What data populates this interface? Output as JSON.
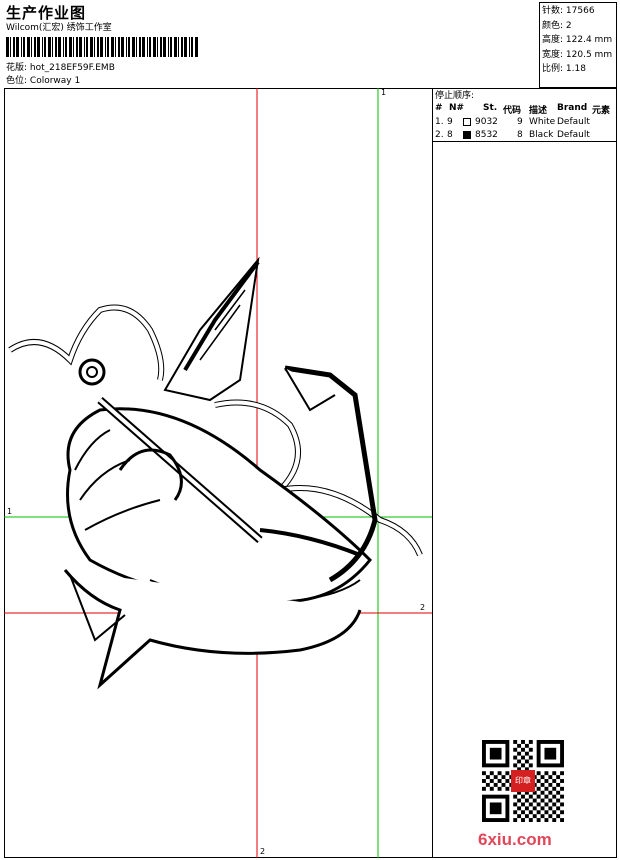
{
  "header": {
    "title": "生产作业图",
    "company": "Wilcom(汇宏) 绣饰工作室",
    "design_label": "花版:",
    "design_value": "hot_218EF59F.EMB",
    "colorway_label": "色位:",
    "colorway_value": "Colorway 1"
  },
  "stats": [
    {
      "label": "针数:",
      "value": "17566"
    },
    {
      "label": "颜色:",
      "value": "2"
    },
    {
      "label": "高度:",
      "value": "122.4 mm"
    },
    {
      "label": "宽度:",
      "value": "120.5 mm"
    },
    {
      "label": "比例:",
      "value": "1.18"
    }
  ],
  "stop_sequence": {
    "title": "停止顺序:",
    "columns": [
      "#",
      "N#",
      "St.",
      "代码",
      "描述",
      "Brand",
      "元素"
    ],
    "rows": [
      {
        "index": "1.",
        "needle": "9",
        "color": "#ffffff",
        "stitches": "9032",
        "code": "9",
        "description": "White",
        "brand": "Default"
      },
      {
        "index": "2.",
        "needle": "8",
        "color": "#000000",
        "stitches": "8532",
        "code": "8",
        "description": "Black",
        "brand": "Default"
      }
    ]
  },
  "guides": {
    "top_green": "1",
    "left_green": "1",
    "right_red": "2",
    "bottom_red": "2"
  },
  "watermark": "6xiu.com",
  "seal_text": "印章"
}
